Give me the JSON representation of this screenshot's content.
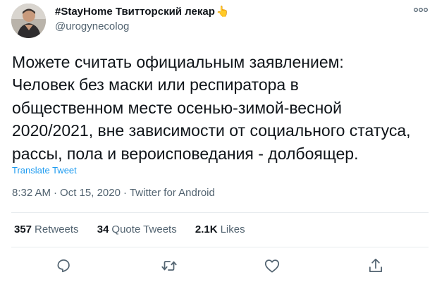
{
  "user": {
    "display_name": "#StayHome Твитторский лекар",
    "name_emoji": "👆",
    "handle": "@urogynecolog"
  },
  "tweet": {
    "lines": [
      "Можете считать официальным заявлением:",
      "Человек без маски или респиратора в",
      "общественном месте осенью-зимой-весной",
      "2020/2021, вне зависимости от социального статуса,",
      "рассы, пола и вероисповедания - долбоящер."
    ],
    "translate_label": "Translate Tweet",
    "time": "8:32 AM",
    "date": "Oct 15, 2020",
    "client": "Twitter for Android",
    "separator": "·"
  },
  "stats": {
    "retweets": {
      "count": "357",
      "label": "Retweets"
    },
    "quote_tweets": {
      "count": "34",
      "label": "Quote Tweets"
    },
    "likes": {
      "count": "2.1K",
      "label": "Likes"
    }
  },
  "icons": {
    "more": "more-icon",
    "reply": "reply-icon",
    "retweet": "retweet-icon",
    "like": "heart-icon",
    "share": "share-icon"
  },
  "colors": {
    "text": "#0f1419",
    "secondary": "#536471",
    "link": "#1d9bf0",
    "divider": "#e8ecef"
  }
}
